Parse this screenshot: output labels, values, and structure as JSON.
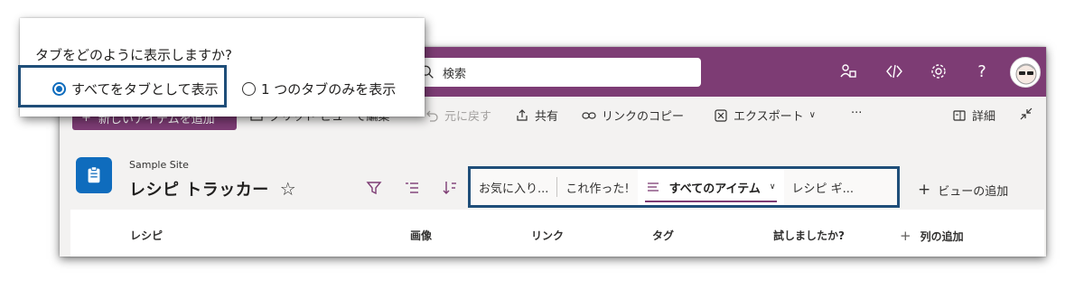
{
  "suite_bar": {
    "search_placeholder": "検索",
    "icons": [
      "people-icon",
      "code-icon",
      "gear-icon",
      "help-icon",
      "avatar"
    ],
    "help_glyph": "?",
    "color": "#7d3c74"
  },
  "command_bar": {
    "new_item": "新しいアイテムを追加",
    "grid_edit": "グリッド ビューで編集",
    "undo": "元に戻す",
    "share": "共有",
    "copy_link": "リンクのコピー",
    "export": "エクスポート",
    "more": "···",
    "details": "詳細"
  },
  "list_header": {
    "site_name": "Sample Site",
    "list_title": "レシピ トラッカー",
    "favorite_glyph": "☆"
  },
  "views": {
    "tabs": [
      {
        "label": "お気に入り..."
      },
      {
        "label": "これ作った!"
      },
      {
        "label": "すべてのアイテム",
        "active": true
      },
      {
        "label": "レシピ ギ..."
      }
    ],
    "add_view": "ビューの追加"
  },
  "grid": {
    "columns": [
      "レシピ",
      "画像",
      "リンク",
      "タグ",
      "試しましたか?"
    ],
    "add_column": "列の追加"
  },
  "popup": {
    "question": "タブをどのように表示しますか?",
    "options": [
      {
        "label": "すべてをタブとして表示",
        "checked": true
      },
      {
        "label": "1 つのタブのみを表示",
        "checked": false
      }
    ]
  }
}
